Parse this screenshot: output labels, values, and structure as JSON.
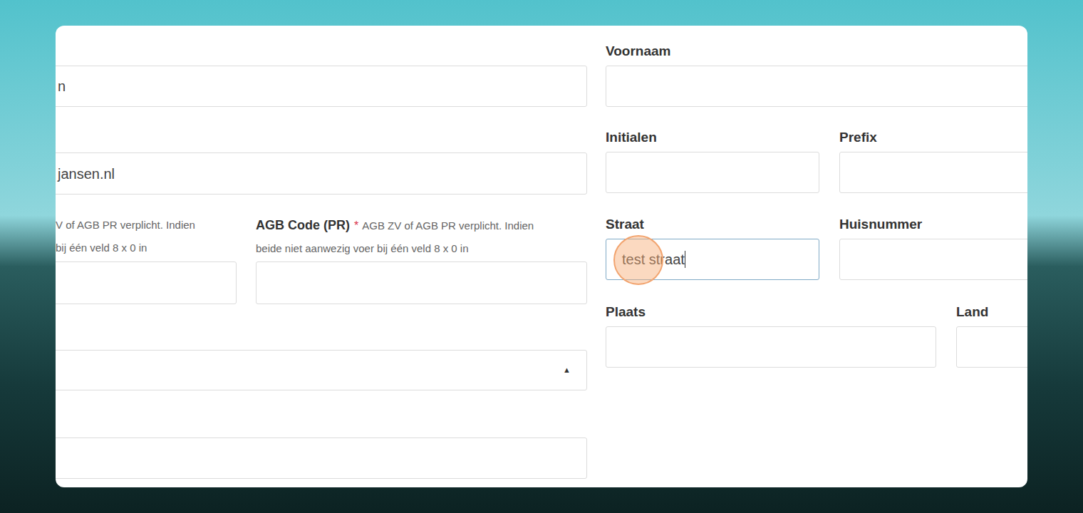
{
  "left_fields": [
    {
      "value": "n"
    },
    {
      "value": "jansen.nl"
    }
  ],
  "agb_fields": [
    {
      "label": "",
      "required_mark": "",
      "hint_lines": [
        "V of AGB PR verplicht. Indien",
        "bij één veld 8 x 0 in"
      ],
      "value": ""
    },
    {
      "label": "AGB Code (PR)",
      "required_mark": "*",
      "hint_lines": [
        "AGB ZV of AGB PR verplicht. Indien",
        "beide niet aanwezig voer bij één veld 8 x 0 in"
      ],
      "value": ""
    }
  ],
  "select": {
    "value": "",
    "caret": "▲",
    "expanded": false
  },
  "bottom_field": {
    "value": ""
  },
  "right_rows": [
    [
      {
        "label": "Voornaam",
        "value": "",
        "focused": false
      }
    ],
    [
      {
        "label": "Initialen",
        "value": "",
        "focused": false
      },
      {
        "label": "Prefix",
        "value": "",
        "focused": false
      }
    ],
    [
      {
        "label": "Straat",
        "value": "test straat",
        "focused": true
      },
      {
        "label": "Huisnummer",
        "value": "",
        "focused": false
      }
    ],
    [
      {
        "label": "Plaats",
        "value": "",
        "focused": false
      },
      {
        "label": "Land",
        "value": "",
        "focused": false
      }
    ]
  ],
  "click_marker": {
    "visible": true
  }
}
